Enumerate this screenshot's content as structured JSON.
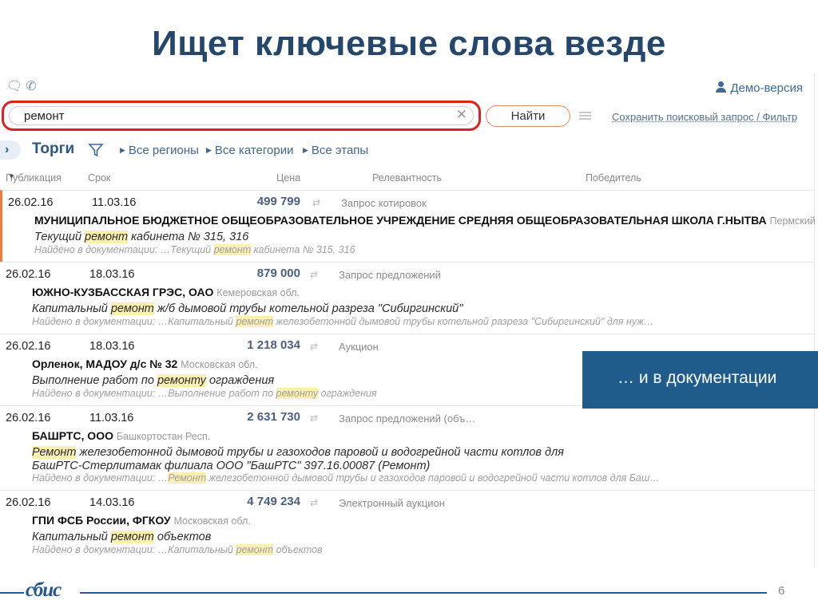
{
  "slide": {
    "title": "Ищет ключевые слова везде",
    "page_number": "6",
    "logo_text": "сбис"
  },
  "topbar": {
    "icons": [
      "chat-icon",
      "phone-icon"
    ],
    "user_label": "Демо-версия"
  },
  "search": {
    "value": "ремонт",
    "find_label": "Найти",
    "save_label": "Сохранить поисковый запрос / Фильтр"
  },
  "toolbar": {
    "title": "Торги",
    "regions": "Все регионы",
    "categories": "Все категории",
    "stages": "Все этапы"
  },
  "columns": {
    "publication": "Публикация",
    "due": "Срок",
    "price": "Цена",
    "relevance": "Релевантность",
    "winner": "Победитель"
  },
  "found_prefix": "Найдено в документации: …",
  "results": [
    {
      "pub": "26.02.16",
      "due": "11.03.16",
      "price": "499 799",
      "type": "Запрос котировок",
      "org": "МУНИЦИПАЛЬНОЕ БЮДЖЕТНОЕ ОБЩЕОБРАЗОВАТЕЛЬНОЕ УЧРЕЖДЕНИЕ СРЕДНЯЯ ОБЩЕОБРАЗОВАТЕЛЬНАЯ ШКОЛА Г.НЫТВА",
      "region": "Пермский …",
      "desc_before": "Текущий ",
      "desc_hl": "ремонт",
      "desc_after": " кабинета № 315, 316",
      "found_before": "Текущий ",
      "found_hl": "ремонт",
      "found_after": " кабинета № 315, 316"
    },
    {
      "pub": "26.02.16",
      "due": "18.03.16",
      "price": "879 000",
      "type": "Запрос предложений",
      "org": "ЮЖНО-КУЗБАССКАЯ ГРЭС, ОАО",
      "region": "Кемеровская обл.",
      "desc_before": "Капитальный ",
      "desc_hl": "ремонт",
      "desc_after": " ж/б дымовой трубы котельной разреза \"Сибиргинский\"",
      "found_before": "Капитальный ",
      "found_hl": "ремонт",
      "found_after": " железобетонной дымовой трубы котельной разреза \"Сибиргинский\" для нуж…"
    },
    {
      "pub": "26.02.16",
      "due": "18.03.16",
      "price": "1 218 034",
      "type": "Аукцион",
      "org": "Орленок, МАДОУ д/с № 32",
      "region": "Московская обл.",
      "desc_before": "Выполнение работ по ",
      "desc_hl": "ремонту",
      "desc_after": " ограждения",
      "found_before": "Выполнение работ по ",
      "found_hl": "ремонту",
      "found_after": " ограждения"
    },
    {
      "pub": "26.02.16",
      "due": "11.03.16",
      "price": "2 631 730",
      "type": "Запрос предложений (объ…",
      "org": "БАШРТС, ООО",
      "region": "Башкортостан Респ.",
      "desc_before": "",
      "desc_hl": "Ремонт",
      "desc_after": " железобетонной дымовой трубы и газоходов паровой и водогрейной части котлов для БашРТС-Стерлитамак филиала ООО \"БашРТС\" 397.16.00087 (Ремонт)",
      "found_before": "",
      "found_hl": "Ремонт",
      "found_after": " железобетонной дымовой трубы и газоходов паровой и водогрейной части котлов для Баш…"
    },
    {
      "pub": "26.02.16",
      "due": "14.03.16",
      "price": "4 749 234",
      "type": "Электронный аукцион",
      "org": "ГПИ ФСБ России, ФГКОУ",
      "region": "Московская обл.",
      "desc_before": "Капитальный ",
      "desc_hl": "ремонт",
      "desc_after": " объектов",
      "found_before": "Капитальный ",
      "found_hl": "ремонт",
      "found_after": " объектов"
    }
  ],
  "callout": {
    "text": "… и в документации"
  },
  "colors": {
    "title": "#24476b",
    "highlight": "#fbf0b0",
    "callout_bg": "#1f5c8c",
    "search_outline": "#e02020",
    "active_row": "#e97b3c"
  }
}
